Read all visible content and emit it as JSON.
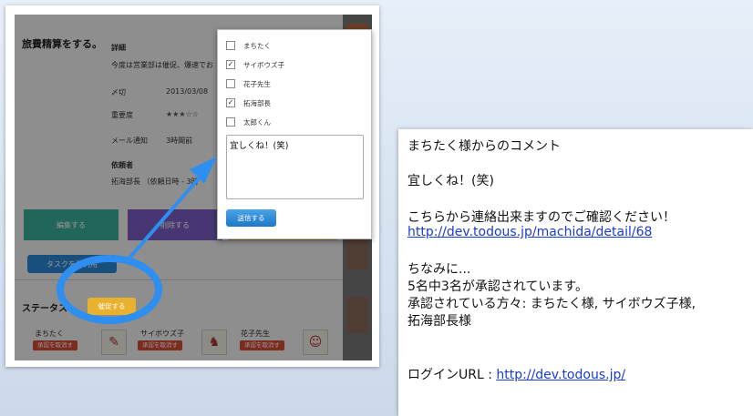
{
  "task": {
    "title": "旅費精算をする。",
    "detail_label": "詳細",
    "detail_text": "今度は営業部は催促、爆速でお",
    "deadline_label": "〆切",
    "deadline_value": "2013/03/08",
    "priority_label": "重要度",
    "priority_value": "★★★☆☆",
    "mail_label": "メール通知",
    "mail_value": "3時間前",
    "requester_label": "依頼者",
    "requester_value": "拓海部長 （依頼日時 - 3時",
    "buttons": {
      "edit": "編集する",
      "delete": "削除する"
    },
    "reopen_label": "タスクを再利用"
  },
  "status": {
    "label": "ステータス",
    "urge_label": "催促する",
    "people": [
      {
        "name": "まちたく",
        "badge": "承認を取消す"
      },
      {
        "name": "サイボウズ子",
        "badge": "承認を取消す"
      },
      {
        "name": "花子先生",
        "badge": "承認を取消す"
      }
    ]
  },
  "popup": {
    "items": [
      {
        "name": "まちたく",
        "checked": false
      },
      {
        "name": "サイボウズ子",
        "checked": true
      },
      {
        "name": "花子先生",
        "checked": false
      },
      {
        "name": "拓海部長",
        "checked": true
      },
      {
        "name": "太郎くん",
        "checked": false
      }
    ],
    "comment": "宜しくね！(笑)",
    "send_label": "送信する"
  },
  "email": {
    "heading": "まちたく様からのコメント",
    "comment": "宜しくね！(笑)",
    "contact": "こちらから連絡出来ますのでご確認ください！",
    "detail_link": "http://dev.todous.jp/machida/detail/68",
    "by_the_way": "ちなみに...",
    "approved_count": "5名中3名が承認されています。",
    "approvers_line1": "承認されている方々: まちたく様, サイボウズ子様,",
    "approvers_line2": "拓海部長様",
    "login_label": "ログインURL : ",
    "login_link": "http://dev.todous.jp/"
  },
  "colors": {
    "edit_btn": "#3bb09a",
    "delete_btn": "#7a5ec4",
    "alert": "#d84a35",
    "urge": "#e8b12e",
    "send": "#2a88d8",
    "highlight": "#2f8ff0"
  }
}
